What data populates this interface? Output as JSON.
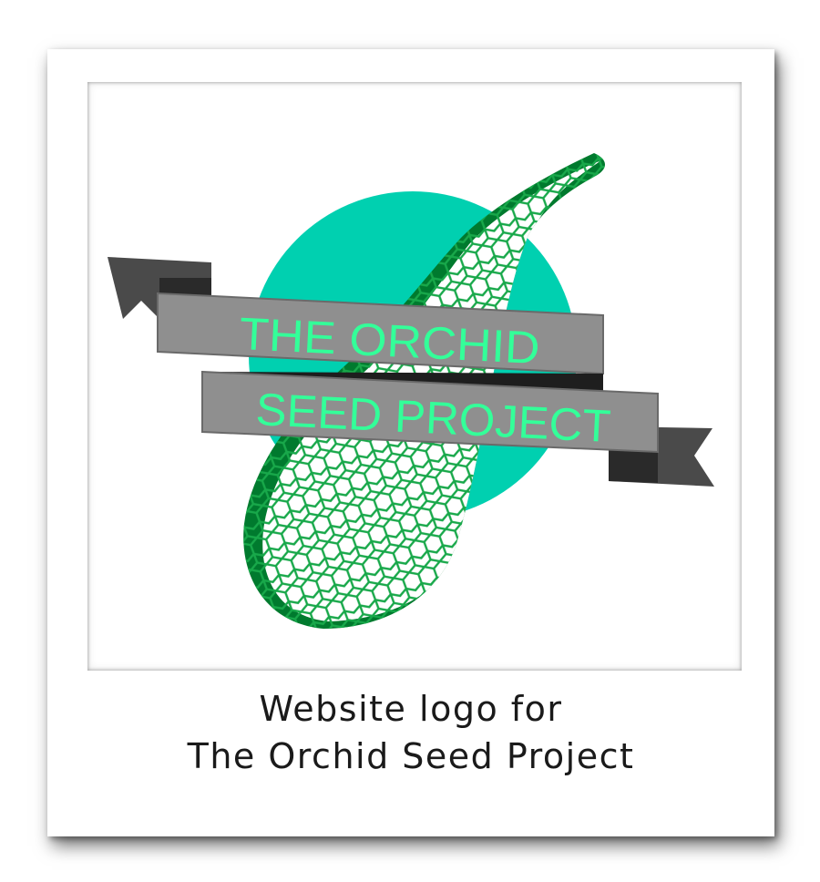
{
  "logo": {
    "banner_line1": "THE ORCHID",
    "banner_line2": "SEED PROJECT",
    "colors": {
      "circle": "#00d0b0",
      "seed_dark": "#007a2e",
      "seed_mesh": "#18a84a",
      "ribbon": "#8f8f8f",
      "ribbon_dark": "#4a4a4a",
      "banner_text": "#33ff99"
    }
  },
  "caption": {
    "line1": "Website logo for",
    "line2": "The Orchid Seed Project"
  }
}
